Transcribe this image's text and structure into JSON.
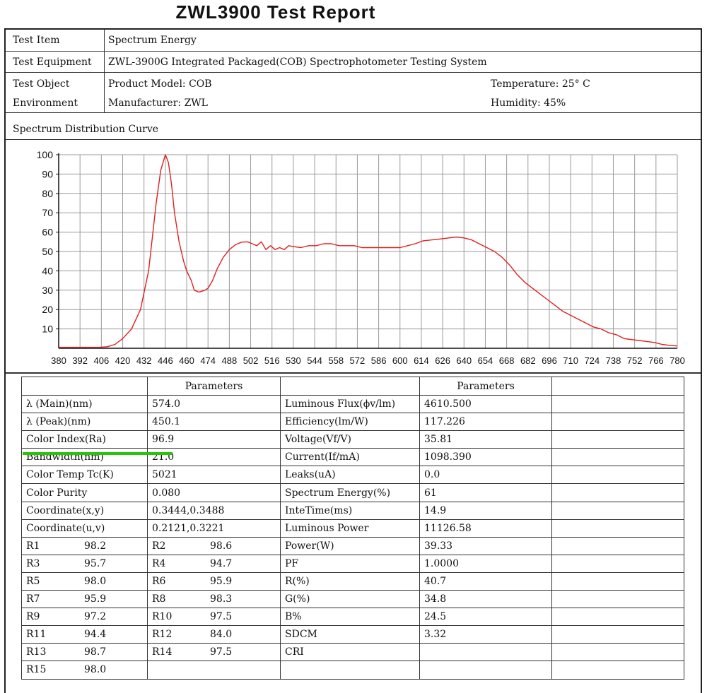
{
  "report": {
    "title": "ZWL3900 Test Report"
  },
  "header": {
    "test_item_label": "Test Item",
    "test_item_value": "Spectrum Energy",
    "equipment_label": "Test Equipment",
    "equipment_value": "ZWL-3900G Integrated Packaged(COB) Spectrophotometer Testing System",
    "object_label": "Test Object",
    "environment_label": "Environment",
    "product_model": "Product Model: COB",
    "manufacturer": "Manufacturer: ZWL",
    "temperature": "Temperature: 25° C",
    "humidity": "Humidity: 45%"
  },
  "chart_section": {
    "label": "Spectrum Distribution Curve"
  },
  "chart_data": {
    "type": "line",
    "title": "Spectrum Distribution Curve",
    "xlabel": "",
    "ylabel": "",
    "xlim": [
      380,
      780
    ],
    "ylim": [
      0,
      100
    ],
    "x_ticks": [
      380,
      392,
      406,
      420,
      432,
      446,
      460,
      474,
      488,
      502,
      516,
      530,
      544,
      558,
      572,
      586,
      600,
      614,
      626,
      640,
      654,
      668,
      682,
      696,
      710,
      724,
      738,
      752,
      766,
      780
    ],
    "y_ticks": [
      10,
      20,
      30,
      40,
      50,
      60,
      70,
      80,
      90,
      100
    ],
    "grid": true,
    "line_color": "#e02020",
    "series": [
      {
        "x": [
          380,
          395,
          400,
          405,
          410,
          415,
          420,
          425,
          430,
          435,
          440,
          443,
          446,
          448,
          450,
          452,
          455,
          458,
          460,
          463,
          465,
          468,
          470,
          472,
          474,
          477,
          480,
          484,
          488,
          492,
          496,
          500,
          503,
          506,
          509,
          512,
          515,
          518,
          521,
          524,
          527,
          530,
          535,
          540,
          545,
          550,
          555,
          560,
          565,
          570,
          575,
          580,
          585,
          590,
          595,
          600,
          605,
          610,
          615,
          620,
          625,
          630,
          635,
          640,
          645,
          650,
          655,
          660,
          665,
          670,
          675,
          680,
          685,
          690,
          695,
          700,
          705,
          710,
          715,
          720,
          725,
          730,
          735,
          740,
          745,
          750,
          755,
          760,
          765,
          770,
          775,
          780
        ],
        "y": [
          0.5,
          0.5,
          0.5,
          0.5,
          0.8,
          2,
          5,
          10,
          20,
          40,
          75,
          92,
          100,
          96,
          85,
          70,
          55,
          45,
          40,
          35,
          30,
          29,
          29.5,
          30,
          31,
          35,
          41,
          47,
          51,
          53.5,
          54.8,
          55,
          54,
          53,
          55,
          51,
          53,
          51,
          52,
          51,
          53,
          52.5,
          52,
          53,
          53,
          54,
          54,
          53,
          53,
          53,
          52,
          52,
          52,
          52,
          52,
          52,
          53,
          54,
          55.5,
          56,
          56.5,
          57,
          57.5,
          57,
          56,
          54,
          52,
          50,
          47,
          43,
          38,
          34,
          31,
          28,
          25,
          22,
          19,
          17,
          15,
          13,
          11,
          10,
          8,
          7,
          5,
          4.5,
          4,
          3.5,
          3,
          2,
          1.5,
          1.2
        ]
      }
    ]
  },
  "params": {
    "header_left": "Parameters",
    "header_right": "Parameters",
    "rows": [
      {
        "l1": "λ (Main)(nm)",
        "v1": "574.0",
        "l2": "Luminous Flux(ϕv/lm)",
        "v2": "4610.500"
      },
      {
        "l1": "λ (Peak)(nm)",
        "v1": "450.1",
        "l2": "Efficiency(lm/W)",
        "v2": "117.226"
      },
      {
        "l1": "Color Index(Ra)",
        "v1": "96.9",
        "l2": "Voltage(Vf/V)",
        "v2": "35.81"
      },
      {
        "l1": "Bandwidth(nm)",
        "v1": "21.0",
        "l2": "Current(If/mA)",
        "v2": "1098.390"
      },
      {
        "l1": "Color Temp Tc(K)",
        "v1": "5021",
        "l2": "Leaks(uA)",
        "v2": "0.0"
      },
      {
        "l1": "Color Purity",
        "v1": "0.080",
        "l2": "Spectrum Energy(%)",
        "v2": "61"
      },
      {
        "l1": "Coordinate(x,y)",
        "v1": "0.3444,0.3488",
        "l2": "InteTime(ms)",
        "v2": "14.9"
      },
      {
        "l1": "Coordinate(u,v)",
        "v1": "0.2121,0.3221",
        "l2": "Luminous Power",
        "v2": "11126.58"
      }
    ],
    "r_rows": [
      {
        "a": "R1",
        "av": "98.2",
        "b": "R2",
        "bv": "98.6",
        "l2": "Power(W)",
        "v2": "39.33"
      },
      {
        "a": "R3",
        "av": "95.7",
        "b": "R4",
        "bv": "94.7",
        "l2": "PF",
        "v2": "1.0000"
      },
      {
        "a": "R5",
        "av": "98.0",
        "b": "R6",
        "bv": "95.9",
        "l2": "R(%)",
        "v2": "40.7"
      },
      {
        "a": "R7",
        "av": "95.9",
        "b": "R8",
        "bv": "98.3",
        "l2": "G(%)",
        "v2": "34.8"
      },
      {
        "a": "R9",
        "av": "97.2",
        "b": "R10",
        "bv": "97.5",
        "l2": "B%",
        "v2": "24.5"
      },
      {
        "a": "R11",
        "av": "94.4",
        "b": "R12",
        "bv": "84.0",
        "l2": "SDCM",
        "v2": "3.32"
      },
      {
        "a": "R13",
        "av": "98.7",
        "b": "R14",
        "bv": "97.5",
        "l2": "CRI",
        "v2": ""
      },
      {
        "a": "R15",
        "av": "98.0",
        "b": "",
        "bv": "",
        "l2": "",
        "v2": ""
      }
    ]
  }
}
